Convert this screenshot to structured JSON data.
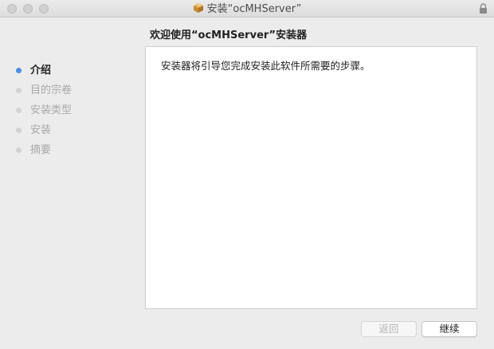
{
  "window": {
    "title": "安装“ocMHServer”"
  },
  "heading": "欢迎使用“ocMHServer”安装器",
  "steps": [
    {
      "label": "介绍",
      "active": true
    },
    {
      "label": "目的宗卷",
      "active": false
    },
    {
      "label": "安装类型",
      "active": false
    },
    {
      "label": "安装",
      "active": false
    },
    {
      "label": "摘要",
      "active": false
    }
  ],
  "content": {
    "text": "安装器将引导您完成安装此软件所需要的步骤。"
  },
  "buttons": {
    "back_label": "返回",
    "continue_label": "继续"
  },
  "icons": {
    "title_icon": "package-icon",
    "lock": "lock-icon"
  },
  "colors": {
    "active_step_dot": "#4a90e2",
    "inactive_step": "#a9a9a9"
  }
}
